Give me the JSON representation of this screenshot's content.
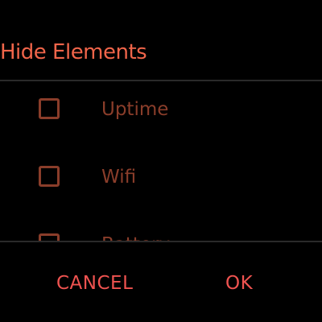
{
  "dialog": {
    "title": "Hide Elements",
    "items": [
      {
        "label": "Uptime",
        "checked": false
      },
      {
        "label": "Wifi",
        "checked": false
      },
      {
        "label": "Battery",
        "checked": false
      }
    ],
    "cancel_label": "CANCEL",
    "ok_label": "OK"
  },
  "colors": {
    "background": "#000000",
    "title": "#f0654a",
    "item": "#8a3d2a",
    "button": "#ef5350",
    "divider": "#2a2a2a"
  }
}
